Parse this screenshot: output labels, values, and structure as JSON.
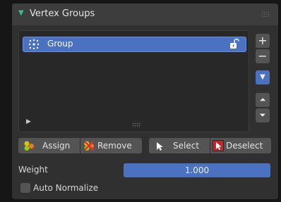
{
  "panel": {
    "title": "Vertex Groups",
    "collapse_icon": "triangle-down-icon"
  },
  "list": {
    "items": [
      {
        "label": "Group",
        "icon": "vertex-group-icon",
        "lock_icon": "unlocked-icon",
        "selected": true
      }
    ]
  },
  "side_buttons": {
    "add_label": "+",
    "remove_label": "−",
    "specials_icon": "chevron-down-icon",
    "move_up_icon": "triangle-up-icon",
    "move_down_icon": "triangle-down-icon"
  },
  "buttons": {
    "assign": "Assign",
    "remove": "Remove",
    "select": "Select",
    "deselect": "Deselect"
  },
  "weight": {
    "label": "Weight",
    "value": "1.000"
  },
  "auto_normalize": {
    "label": "Auto Normalize",
    "checked": false
  },
  "colors": {
    "accent_blue": "#4a72c0",
    "header_green": "#2fc48a",
    "panel_bg": "#303030"
  }
}
